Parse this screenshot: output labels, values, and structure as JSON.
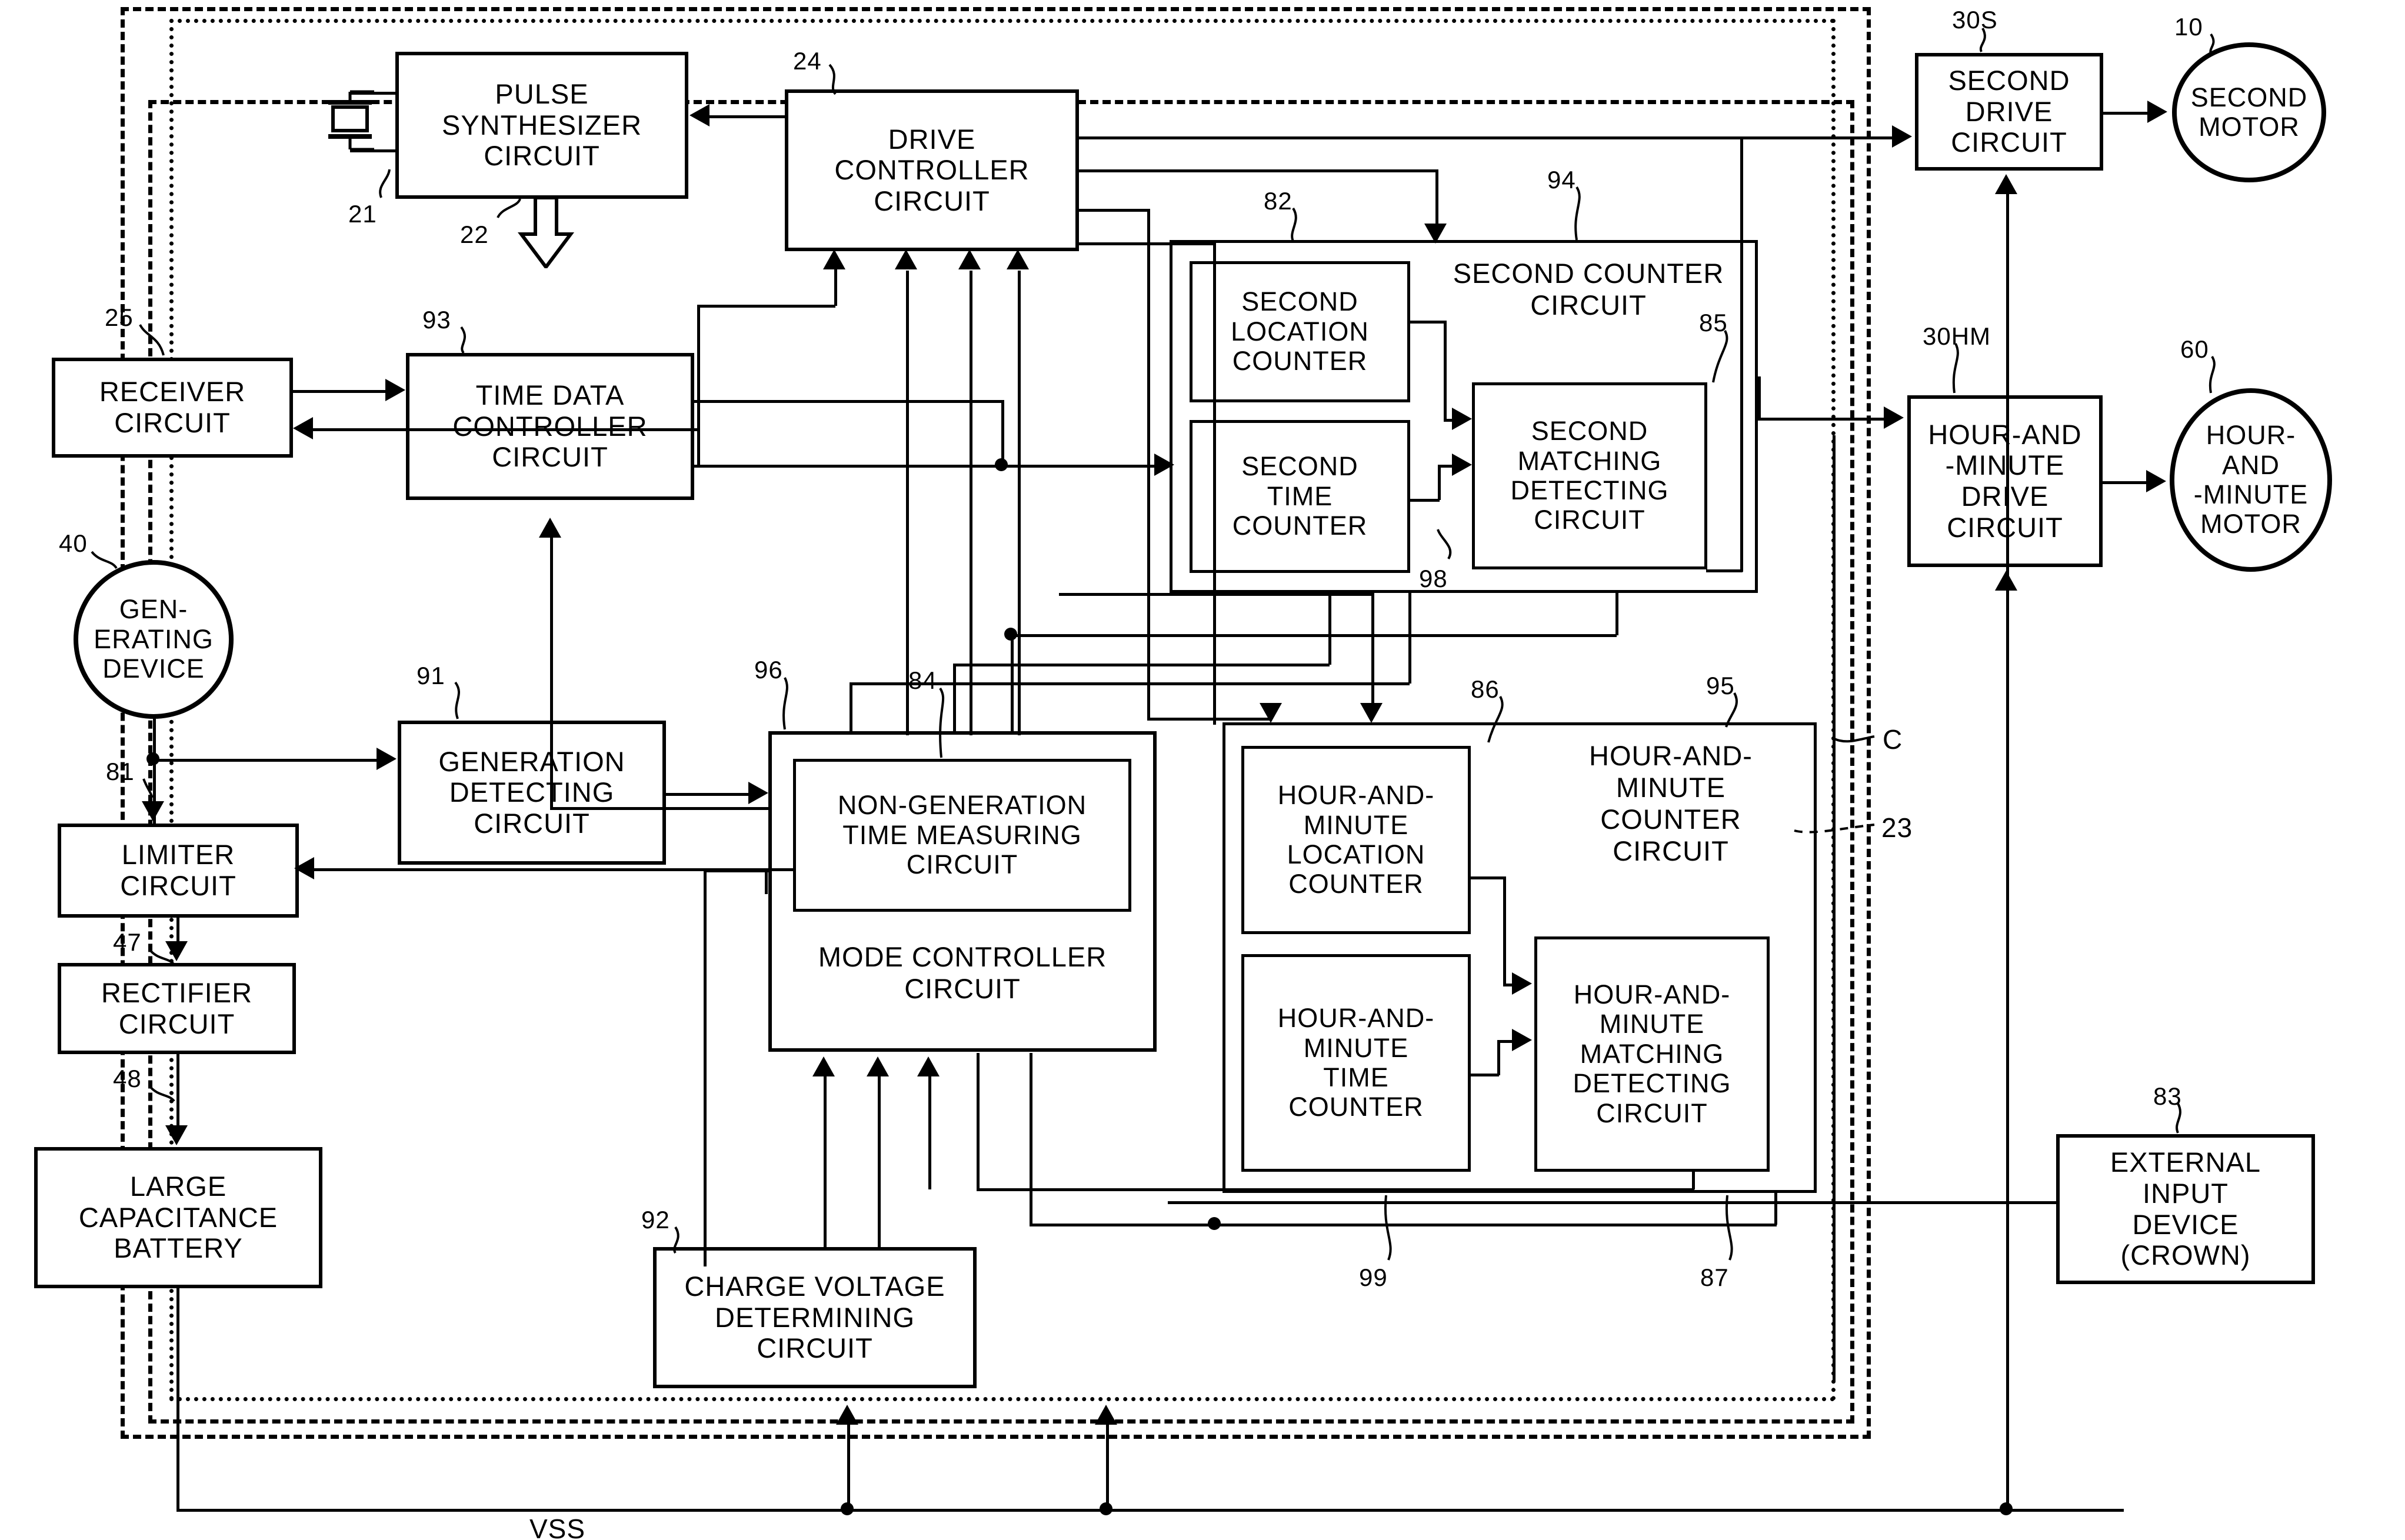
{
  "figure": {
    "type": "patent-block-diagram",
    "ground_label": "VSS"
  },
  "blocks": {
    "pulse_synth": {
      "label": "PULSE\nSYNTHESIZER\nCIRCUIT"
    },
    "drive_controller": {
      "label": "DRIVE\nCONTROLLER\nCIRCUIT"
    },
    "receiver": {
      "label": "RECEIVER\nCIRCUIT"
    },
    "time_data": {
      "label": "TIME DATA\nCONTROLLER\nCIRCUIT"
    },
    "generating_device": {
      "label": "GEN-\nERATING\nDEVICE"
    },
    "limiter": {
      "label": "LIMITER\nCIRCUIT"
    },
    "rectifier": {
      "label": "RECTIFIER\nCIRCUIT"
    },
    "battery": {
      "label": "LARGE\nCAPACITANCE\nBATTERY"
    },
    "generation_detect": {
      "label": "GENERATION\nDETECTING\nCIRCUIT"
    },
    "mode_controller": {
      "label": "MODE CONTROLLER\nCIRCUIT"
    },
    "non_generation": {
      "label": "NON-GENERATION\nTIME MEASURING\nCIRCUIT"
    },
    "charge_voltage": {
      "label": "CHARGE VOLTAGE\nDETERMINING\nCIRCUIT"
    },
    "second_counter": {
      "label": "SECOND COUNTER\nCIRCUIT"
    },
    "second_location": {
      "label": "SECOND\nLOCATION\nCOUNTER"
    },
    "second_time": {
      "label": "SECOND\nTIME\nCOUNTER"
    },
    "second_match": {
      "label": "SECOND\nMATCHING\nDETECTING\nCIRCUIT"
    },
    "hm_counter": {
      "label": "HOUR-AND-\nMINUTE\nCOUNTER\nCIRCUIT"
    },
    "hm_location": {
      "label": "HOUR-AND-\nMINUTE\nLOCATION\nCOUNTER"
    },
    "hm_time": {
      "label": "HOUR-AND-\nMINUTE\nTIME\nCOUNTER"
    },
    "hm_match": {
      "label": "HOUR-AND-\nMINUTE\nMATCHING\nDETECTING\nCIRCUIT"
    },
    "second_drive": {
      "label": "SECOND\nDRIVE\nCIRCUIT"
    },
    "second_motor": {
      "label": "SECOND\nMOTOR"
    },
    "hm_drive": {
      "label": "HOUR-AND\n-MINUTE\nDRIVE\nCIRCUIT"
    },
    "hm_motor": {
      "label": "HOUR-\nAND\n-MINUTE\nMOTOR"
    },
    "external_input": {
      "label": "EXTERNAL\nINPUT\nDEVICE\n(CROWN)"
    }
  },
  "refs": {
    "r10": "10",
    "r21": "21",
    "r22": "22",
    "r23": "23",
    "r24": "24",
    "r25": "25",
    "r30s": "30S",
    "r30hm": "30HM",
    "r40": "40",
    "r47": "47",
    "r48": "48",
    "r60": "60",
    "r81": "81",
    "r82": "82",
    "r83": "83",
    "r84": "84",
    "r85": "85",
    "r86": "86",
    "r87": "87",
    "r91": "91",
    "r92": "92",
    "r93": "93",
    "r94": "94",
    "r95": "95",
    "r96": "96",
    "r98": "98",
    "r99": "99",
    "rC": "C"
  }
}
